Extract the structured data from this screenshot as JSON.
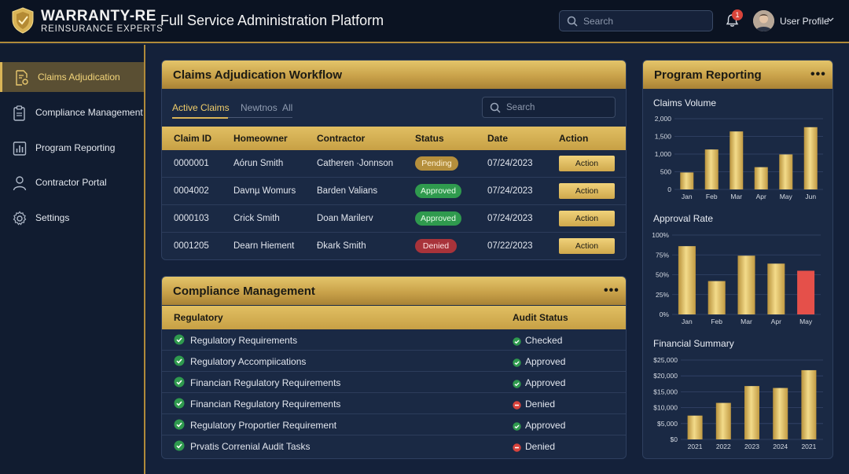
{
  "header": {
    "brand_line1": "WARRANTY-RE",
    "brand_line2": "REINSURANCE EXPERTS",
    "app_title": "Full Service Administration Platform",
    "search_placeholder": "Search",
    "notification_count": "1",
    "profile_label": "User Profile"
  },
  "sidebar": {
    "items": [
      {
        "label": "Claims Adjudication",
        "icon": "document-gear-icon",
        "active": true
      },
      {
        "label": "Compliance Management",
        "icon": "clipboard-icon",
        "active": false
      },
      {
        "label": "Program Reporting",
        "icon": "bar-chart-icon",
        "active": false
      },
      {
        "label": "Contractor Portal",
        "icon": "user-icon",
        "active": false
      },
      {
        "label": "Settings",
        "icon": "gear-icon",
        "active": false
      }
    ]
  },
  "claims": {
    "title": "Claims Adjudication Workflow",
    "tabs": [
      {
        "label": "Active Claims",
        "active": true
      },
      {
        "label": "Newtnos",
        "active": false
      },
      {
        "label": "All",
        "active": false
      }
    ],
    "search_placeholder": "Search",
    "columns": [
      "Claim ID",
      "Homeowner",
      "Contractor",
      "Status",
      "Date",
      "Action"
    ],
    "rows": [
      {
        "id": "0000001",
        "homeowner": "Aórun Smith",
        "contractor": "Catheren ∙Jonnson",
        "status": "Pending",
        "status_type": "pending",
        "date": "07/24/2023",
        "action": "Action"
      },
      {
        "id": "0004002",
        "homeowner": "Davnµ Womurs",
        "contractor": "Barden Valians",
        "status": "Approved",
        "status_type": "approved",
        "date": "07/24/2023",
        "action": "Action"
      },
      {
        "id": "0000103",
        "homeowner": "Crick Smith",
        "contractor": "Doan Marilerv",
        "status": "Approved",
        "status_type": "approved",
        "date": "07/24/2023",
        "action": "Action"
      },
      {
        "id": "0001205",
        "homeowner": "Dearn Hiement",
        "contractor": "Ðkark Smith",
        "status": "Denied",
        "status_type": "denied",
        "date": "07/22/2023",
        "action": "Action"
      }
    ]
  },
  "compliance": {
    "title": "Compliance Management",
    "columns": [
      "Regulatory",
      "Audit Status"
    ],
    "rows": [
      {
        "item": "Regulatory Requirements",
        "status": "Checked",
        "status_type": "ok"
      },
      {
        "item": "Regulatory Accompiications",
        "status": "Approved",
        "status_type": "ok"
      },
      {
        "item": "Financian Regulatory Requirements",
        "status": "Approved",
        "status_type": "ok"
      },
      {
        "item": "Financian Regulatory Requirements",
        "status": "Denied",
        "status_type": "denied"
      },
      {
        "item": "Regulatory Proportier Requirement",
        "status": "Approved",
        "status_type": "ok"
      },
      {
        "item": "Prvatis Correnial Audit Tasks",
        "status": "Denied",
        "status_type": "denied"
      }
    ]
  },
  "reporting": {
    "title": "Program Reporting",
    "colors": {
      "bar": "#e2c05e",
      "bar_highlight": "#e5504a"
    }
  },
  "chart_data": [
    {
      "type": "bar",
      "title": "Claims Volume",
      "categories": [
        "Jan",
        "Feb",
        "Mar",
        "Apr",
        "May",
        "Jun"
      ],
      "values": [
        480,
        1130,
        1640,
        630,
        990,
        1760
      ],
      "yticks": [
        "2,000",
        "1,500",
        "1,000",
        "500",
        "0"
      ],
      "ylim": [
        0,
        2000
      ],
      "grid": true
    },
    {
      "type": "bar",
      "title": "Approval Rate",
      "categories": [
        "Jan",
        "Feb",
        "Mar",
        "Apr",
        "May"
      ],
      "values": [
        86,
        42,
        74,
        64,
        55
      ],
      "highlight_index": 4,
      "yticks": [
        "100%",
        "75%",
        "50%",
        "25%",
        "0%"
      ],
      "ylim": [
        0,
        100
      ],
      "grid": true
    },
    {
      "type": "bar",
      "title": "Financial Summary",
      "categories": [
        "2021",
        "2022",
        "2023",
        "2024",
        "2021"
      ],
      "values": [
        7500,
        11500,
        16800,
        16200,
        21800
      ],
      "yticks": [
        "$25,000",
        "$20,000",
        "$15,000",
        "$10,000",
        "$5,000",
        "$0"
      ],
      "ylim": [
        0,
        25000
      ],
      "grid": true
    }
  ]
}
